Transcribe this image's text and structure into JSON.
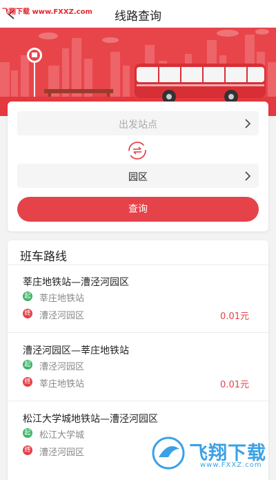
{
  "watermark_top": "飞翔下载 www.FXXZ.com",
  "header": {
    "title": "线路查询"
  },
  "search": {
    "from_placeholder": "出发站点",
    "to_value": "园区",
    "query_label": "查询"
  },
  "routes_section": {
    "title": "班车路线",
    "start_badge": "起",
    "end_badge": "终",
    "routes": [
      {
        "name": "莘庄地铁站—漕泾河园区",
        "start": "莘庄地铁站",
        "end": "漕泾河园区",
        "price": "0.01元"
      },
      {
        "name": "漕泾河园区—莘庄地铁站",
        "start": "漕泾河园区",
        "end": "莘庄地铁站",
        "price": "0.01元"
      },
      {
        "name": "松江大学城地铁站—漕泾河园区",
        "start": "松江大学城",
        "end": "漕泾河园区",
        "price": ""
      }
    ]
  },
  "watermark_bottom": {
    "text": "飞翔下载",
    "url": "www.FXXZ.com"
  },
  "colors": {
    "accent": "#e5424a",
    "start_green": "#3fb568",
    "watermark_blue": "#3aa1e6"
  }
}
